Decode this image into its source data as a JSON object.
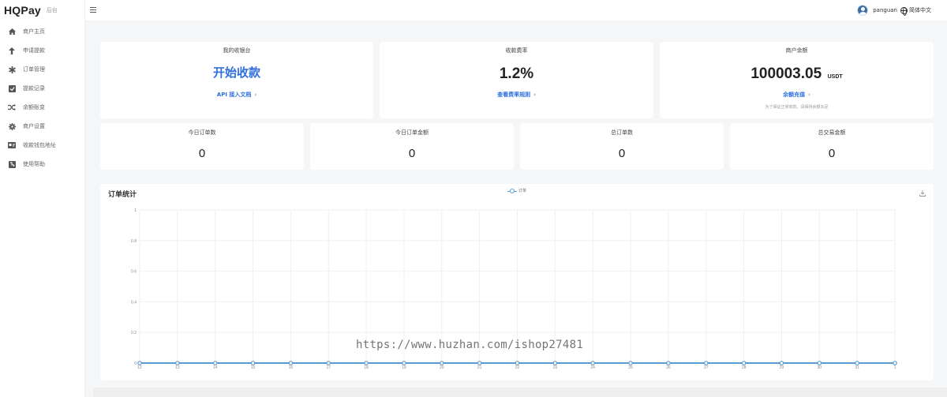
{
  "brand": {
    "name": "HQPay",
    "sub": "后台"
  },
  "sidebar": {
    "items": [
      {
        "label": "商户主页",
        "icon": "home-icon"
      },
      {
        "label": "申请提款",
        "icon": "arrow-up-icon"
      },
      {
        "label": "订单管理",
        "icon": "asterisk-icon"
      },
      {
        "label": "提款记录",
        "icon": "check-square-icon"
      },
      {
        "label": "余额账变",
        "icon": "shuffle-icon"
      },
      {
        "label": "商户设置",
        "icon": "gear-icon"
      },
      {
        "label": "收款钱包地址",
        "icon": "card-icon"
      },
      {
        "label": "使用帮助",
        "icon": "help-book-icon"
      }
    ]
  },
  "header": {
    "username": "panguan",
    "language": "简体中文"
  },
  "cards": {
    "workbench": {
      "title": "我的收银台",
      "big": "开始收款",
      "link": "API 接入文档"
    },
    "rate": {
      "title": "收款费率",
      "big": "1.2%",
      "link": "查看费率规则"
    },
    "balance": {
      "title": "商户余额",
      "big": "100003.05",
      "unit": "USDT",
      "link": "余额充值",
      "note": "为了保证正常收款，请保持余额充足"
    }
  },
  "stats": [
    {
      "title": "今日订单数",
      "value": "0"
    },
    {
      "title": "今日订单金额",
      "value": "0"
    },
    {
      "title": "总订单数",
      "value": "0"
    },
    {
      "title": "总交易金额",
      "value": "0"
    }
  ],
  "chart_title": "订单统计",
  "watermark": "https://www.huzhan.com/ishop27481",
  "colors": {
    "accent": "#2f6fe0",
    "series": "#5b9bd5"
  },
  "chart_data": {
    "type": "line",
    "title": "订单统计",
    "x": [
      "12",
      "13",
      "14",
      "15",
      "16",
      "17",
      "18",
      "19",
      "20",
      "21",
      "22",
      "23",
      "24",
      "25",
      "26",
      "27",
      "28",
      "29",
      "30",
      "31",
      "1"
    ],
    "series": [
      {
        "name": "订单",
        "values": [
          0,
          0,
          0,
          0,
          0,
          0,
          0,
          0,
          0,
          0,
          0,
          0,
          0,
          0,
          0,
          0,
          0,
          0,
          0,
          0,
          0
        ]
      }
    ],
    "yticks": [
      "0",
      "0.2",
      "0.4",
      "0.6",
      "0.8",
      "1"
    ],
    "ylim": [
      0,
      1
    ],
    "grid": true,
    "legend": "top-center"
  }
}
